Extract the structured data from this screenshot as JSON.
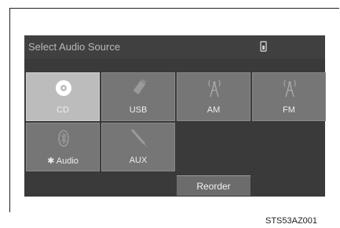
{
  "screen": {
    "title": "Select Audio Source",
    "status_icon": "phone-battery-icon"
  },
  "sources": [
    {
      "label": "CD",
      "icon": "disc-icon",
      "selected": true
    },
    {
      "label": "USB",
      "icon": "usb-icon",
      "selected": false
    },
    {
      "label": "AM",
      "icon": "radio-antenna-icon",
      "selected": false
    },
    {
      "label": "FM",
      "icon": "radio-antenna-icon",
      "selected": false
    },
    {
      "label": "Audio",
      "icon": "bluetooth-icon",
      "selected": false
    },
    {
      "label": "AUX",
      "icon": "aux-cable-icon",
      "selected": false
    }
  ],
  "reorder_label": "Reorder",
  "figure_code": "STS53AZ001"
}
